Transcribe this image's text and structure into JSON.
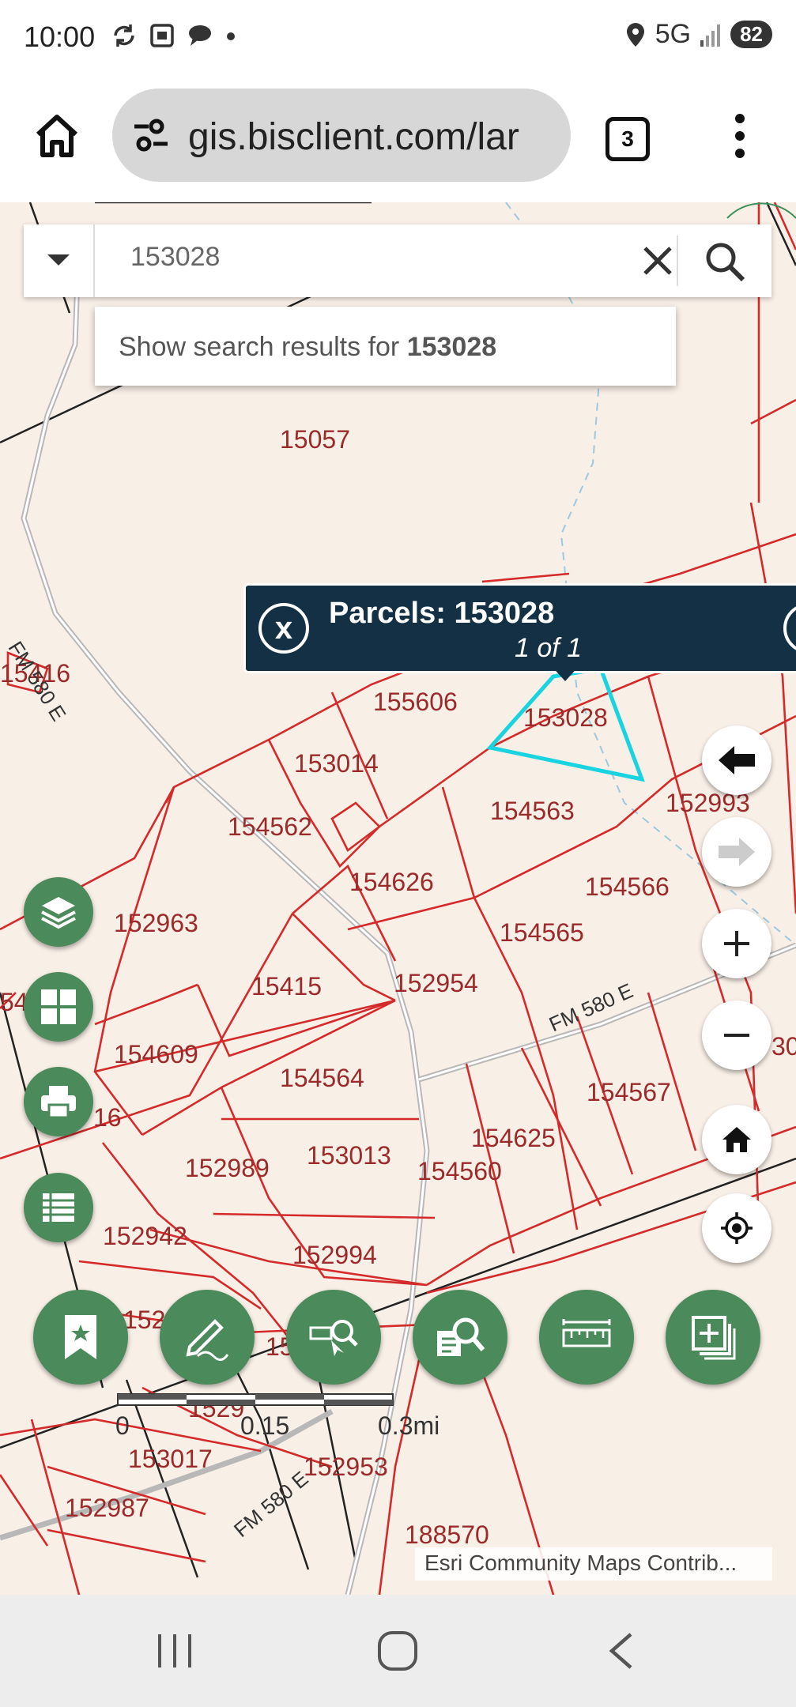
{
  "status_bar": {
    "time": "10:00",
    "network": "5G",
    "battery": "82"
  },
  "browser": {
    "url": "gis.bisclient.com/lar",
    "tab_count": "3"
  },
  "search": {
    "value": "153028",
    "suggestion_prefix": "Show search results for ",
    "suggestion_term": "153028"
  },
  "popup": {
    "title": "Parcels: 153028",
    "count": "1 of 1",
    "close_glyph": "x"
  },
  "parcel_labels": [
    "15057",
    "15416",
    "155606",
    "153028",
    "153014",
    "154563",
    "152993",
    "154562",
    "154626",
    "154566",
    "152963",
    "154565",
    "15415",
    "152954",
    "54",
    "154609",
    "154564",
    "30",
    "16",
    "154567",
    "154625",
    "152989",
    "153013",
    "154560",
    "152942",
    "152994",
    "152",
    "15",
    "1529",
    "153017",
    "152953",
    "152987",
    "188570"
  ],
  "road_labels": [
    "FM 580 E",
    "FM 580 E",
    "FM 580 E"
  ],
  "scale": {
    "labels": [
      "0",
      "0.15",
      "0.3mi"
    ]
  },
  "attribution": "Esri Community Maps Contrib...",
  "colors": {
    "parcel_line": "#d42a2a",
    "selected_parcel": "#19d4e0",
    "popup_bg": "#133044",
    "tool_green": "#4b8a5a",
    "map_bg": "#f8efe6"
  },
  "icons": {
    "side_tools": [
      "layers-icon",
      "basemap-grid-icon",
      "print-icon",
      "table-list-icon"
    ],
    "nav_tools": [
      "back-arrow-icon",
      "forward-arrow-icon",
      "zoom-in-icon",
      "zoom-out-icon",
      "home-icon",
      "locate-icon"
    ],
    "bottom_tools": [
      "bookmark-icon",
      "draw-icon",
      "select-search-icon",
      "query-search-icon",
      "measure-icon",
      "add-data-icon"
    ]
  }
}
